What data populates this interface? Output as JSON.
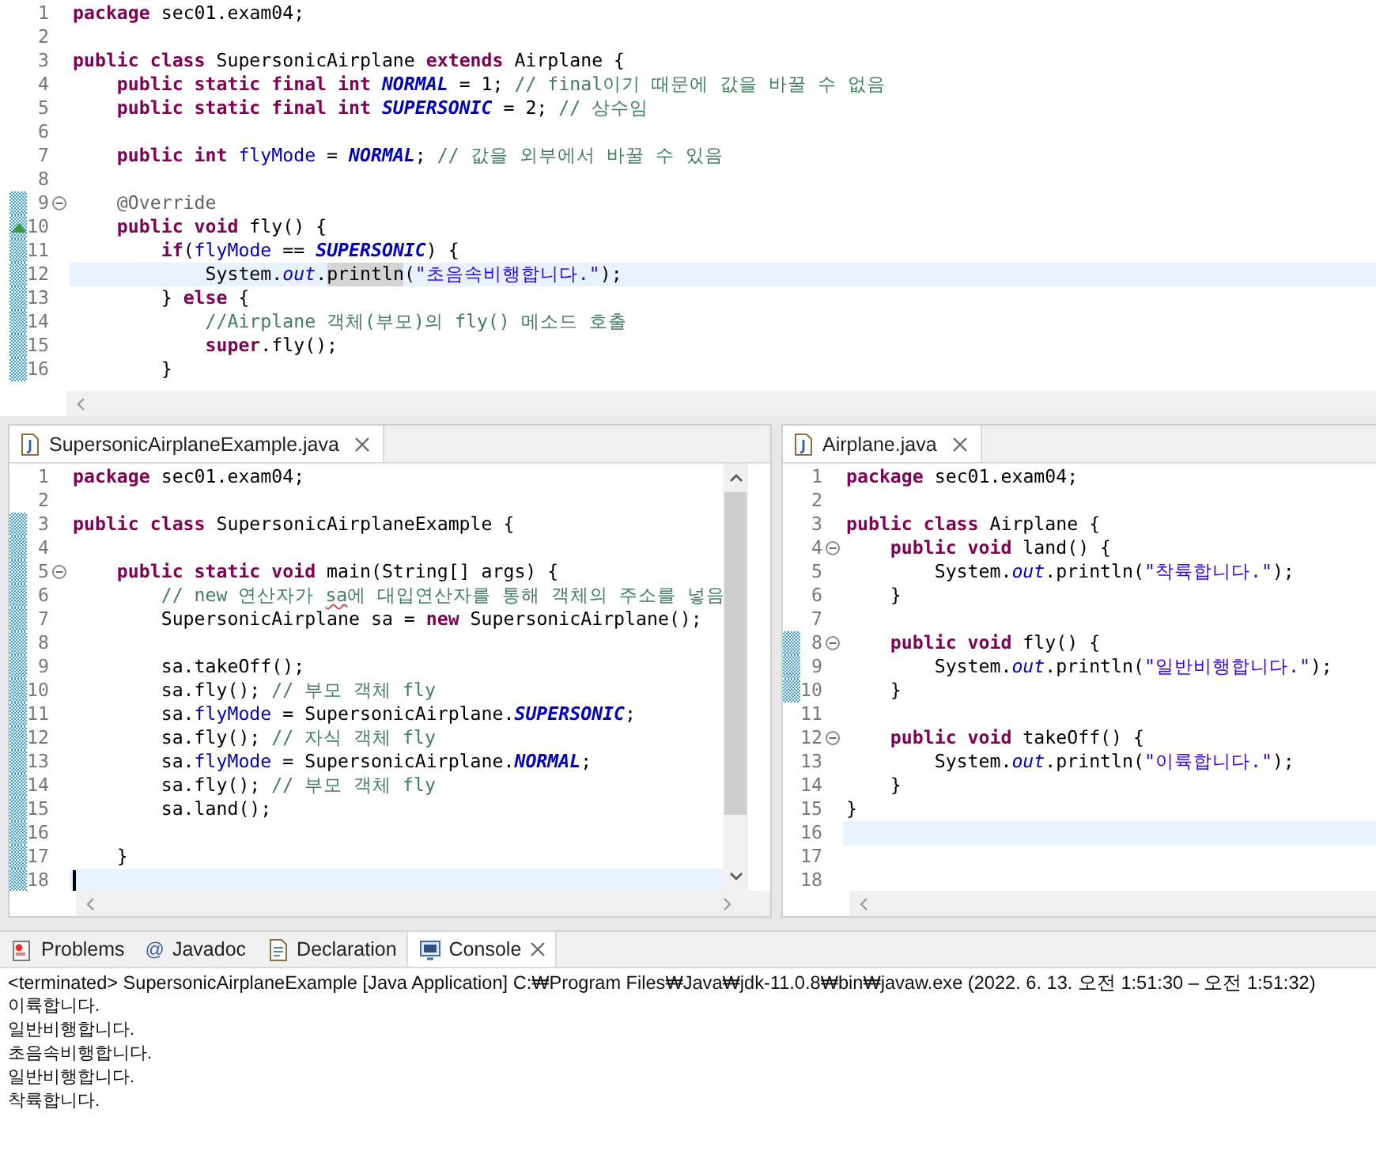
{
  "top_editor": {
    "horizontal_scrollbar": true,
    "vertical_scrollbar": false,
    "lines": [
      {
        "number": "1",
        "changed": false,
        "current": false,
        "fold": false,
        "tokens": [
          {
            "kind": "keyword",
            "text": "package"
          },
          {
            "kind": "plain",
            "text": " sec01.exam04;"
          }
        ]
      },
      {
        "number": "2",
        "changed": false,
        "current": false,
        "fold": false
      },
      {
        "number": "3",
        "changed": false,
        "current": false,
        "fold": false,
        "tokens": [
          {
            "kind": "keyword",
            "text": "public class"
          },
          {
            "kind": "plain",
            "text": " SupersonicAirplane "
          },
          {
            "kind": "keyword",
            "text": "extends"
          },
          {
            "kind": "plain",
            "text": " Airplane {"
          }
        ]
      },
      {
        "number": "4",
        "changed": false,
        "current": false,
        "fold": false,
        "tokens": [
          {
            "kind": "keyword",
            "text": "    public static final int "
          },
          {
            "kind": "constant",
            "text": "NORMAL"
          },
          {
            "kind": "plain",
            "text": " = 1; "
          },
          {
            "kind": "comment",
            "text": "// final이기 때문에 값을 바꿀 수 없음"
          }
        ]
      },
      {
        "number": "5",
        "changed": false,
        "current": false,
        "fold": false,
        "tokens": [
          {
            "kind": "keyword",
            "text": "    public static final int "
          },
          {
            "kind": "constant",
            "text": "SUPERSONIC"
          },
          {
            "kind": "plain",
            "text": " = 2; "
          },
          {
            "kind": "comment",
            "text": "// 상수임"
          }
        ]
      },
      {
        "number": "6",
        "changed": false,
        "current": false,
        "fold": false
      },
      {
        "number": "7",
        "changed": false,
        "current": false,
        "fold": false,
        "tokens": [
          {
            "kind": "keyword",
            "text": "    public int "
          },
          {
            "kind": "field",
            "text": "flyMode"
          },
          {
            "kind": "plain",
            "text": " = "
          },
          {
            "kind": "constant",
            "text": "NORMAL"
          },
          {
            "kind": "plain",
            "text": "; "
          },
          {
            "kind": "comment",
            "text": "// 값을 외부에서 바꿀 수 있음"
          }
        ]
      },
      {
        "number": "8",
        "changed": false,
        "current": false,
        "fold": false
      },
      {
        "number": "9",
        "changed": true,
        "current": false,
        "fold": true,
        "tokens": [
          {
            "kind": "annotation",
            "text": "    @Override"
          }
        ]
      },
      {
        "number": "10",
        "changed": true,
        "current": false,
        "fold": false,
        "override": true,
        "tokens": [
          {
            "kind": "keyword",
            "text": "    public void"
          },
          {
            "kind": "plain",
            "text": " fly() {"
          }
        ]
      },
      {
        "number": "11",
        "changed": true,
        "current": false,
        "fold": false,
        "tokens": [
          {
            "kind": "keyword",
            "text": "        if"
          },
          {
            "kind": "plain",
            "text": "("
          },
          {
            "kind": "field",
            "text": "flyMode"
          },
          {
            "kind": "plain",
            "text": " == "
          },
          {
            "kind": "constant",
            "text": "SUPERSONIC"
          },
          {
            "kind": "plain",
            "text": ") {"
          }
        ]
      },
      {
        "number": "12",
        "changed": true,
        "current": true,
        "fold": false,
        "tokens": [
          {
            "kind": "plain",
            "text": "            System."
          },
          {
            "kind": "static",
            "text": "out"
          },
          {
            "kind": "plain",
            "text": "."
          },
          {
            "kind": "occurrence",
            "text": "println"
          },
          {
            "kind": "plain",
            "text": "("
          },
          {
            "kind": "string",
            "text": "\"초음속비행합니다.\""
          },
          {
            "kind": "plain",
            "text": ");"
          }
        ]
      },
      {
        "number": "13",
        "changed": true,
        "current": false,
        "fold": false,
        "tokens": [
          {
            "kind": "plain",
            "text": "        } "
          },
          {
            "kind": "keyword",
            "text": "else"
          },
          {
            "kind": "plain",
            "text": " {"
          }
        ]
      },
      {
        "number": "14",
        "changed": true,
        "current": false,
        "fold": false,
        "tokens": [
          {
            "kind": "comment",
            "text": "            //Airplane 객체(부모)의 fly() 메소드 호출"
          }
        ]
      },
      {
        "number": "15",
        "changed": true,
        "current": false,
        "fold": false,
        "tokens": [
          {
            "kind": "keyword",
            "text": "            super"
          },
          {
            "kind": "plain",
            "text": ".fly();"
          }
        ]
      },
      {
        "number": "16",
        "changed": true,
        "current": false,
        "fold": false,
        "tokens": [
          {
            "kind": "plain",
            "text": "        }"
          }
        ]
      }
    ]
  },
  "editors": [
    {
      "tab_label": "SupersonicAirplaneExample.java",
      "horizontal_scrollbar": true,
      "vertical_scrollbar": true,
      "lines": [
        {
          "number": "1",
          "changed": false,
          "current": false,
          "fold": false,
          "tokens": [
            {
              "kind": "keyword",
              "text": "package"
            },
            {
              "kind": "plain",
              "text": " sec01.exam04;"
            }
          ]
        },
        {
          "number": "2",
          "changed": false,
          "current": false,
          "fold": false
        },
        {
          "number": "3",
          "changed": true,
          "current": false,
          "fold": false,
          "tokens": [
            {
              "kind": "keyword",
              "text": "public class"
            },
            {
              "kind": "plain",
              "text": " SupersonicAirplaneExample {"
            }
          ]
        },
        {
          "number": "4",
          "changed": true,
          "current": false,
          "fold": false
        },
        {
          "number": "5",
          "changed": true,
          "current": false,
          "fold": true,
          "tokens": [
            {
              "kind": "keyword",
              "text": "    public static void"
            },
            {
              "kind": "plain",
              "text": " main(String[] args) {"
            }
          ]
        },
        {
          "number": "6",
          "changed": true,
          "current": false,
          "fold": false,
          "tokens": [
            {
              "kind": "comment",
              "text": "        // new 연산자가 "
            },
            {
              "kind": "misspelled",
              "text": "sa"
            },
            {
              "kind": "comment",
              "text": "에 대입연산자를 통해 객체의 주소를 넣음"
            }
          ]
        },
        {
          "number": "7",
          "changed": true,
          "current": false,
          "fold": false,
          "tokens": [
            {
              "kind": "plain",
              "text": "        SupersonicAirplane sa = "
            },
            {
              "kind": "keyword",
              "text": "new"
            },
            {
              "kind": "plain",
              "text": " SupersonicAirplane();"
            }
          ]
        },
        {
          "number": "8",
          "changed": true,
          "current": false,
          "fold": false
        },
        {
          "number": "9",
          "changed": true,
          "current": false,
          "fold": false,
          "tokens": [
            {
              "kind": "plain",
              "text": "        sa.takeOff();"
            }
          ]
        },
        {
          "number": "10",
          "changed": true,
          "current": false,
          "fold": false,
          "tokens": [
            {
              "kind": "plain",
              "text": "        sa.fly(); "
            },
            {
              "kind": "comment",
              "text": "// 부모 객체 fly"
            }
          ]
        },
        {
          "number": "11",
          "changed": true,
          "current": false,
          "fold": false,
          "tokens": [
            {
              "kind": "plain",
              "text": "        sa."
            },
            {
              "kind": "field",
              "text": "flyMode"
            },
            {
              "kind": "plain",
              "text": " = SupersonicAirplane."
            },
            {
              "kind": "constant",
              "text": "SUPERSONIC"
            },
            {
              "kind": "plain",
              "text": ";"
            }
          ]
        },
        {
          "number": "12",
          "changed": true,
          "current": false,
          "fold": false,
          "tokens": [
            {
              "kind": "plain",
              "text": "        sa.fly(); "
            },
            {
              "kind": "comment",
              "text": "// 자식 객체 fly"
            }
          ]
        },
        {
          "number": "13",
          "changed": true,
          "current": false,
          "fold": false,
          "tokens": [
            {
              "kind": "plain",
              "text": "        sa."
            },
            {
              "kind": "field",
              "text": "flyMode"
            },
            {
              "kind": "plain",
              "text": " = SupersonicAirplane."
            },
            {
              "kind": "constant",
              "text": "NORMAL"
            },
            {
              "kind": "plain",
              "text": ";"
            }
          ]
        },
        {
          "number": "14",
          "changed": true,
          "current": false,
          "fold": false,
          "tokens": [
            {
              "kind": "plain",
              "text": "        sa.fly(); "
            },
            {
              "kind": "comment",
              "text": "// 부모 객체 fly"
            }
          ]
        },
        {
          "number": "15",
          "changed": true,
          "current": false,
          "fold": false,
          "tokens": [
            {
              "kind": "plain",
              "text": "        sa.land();"
            }
          ]
        },
        {
          "number": "16",
          "changed": true,
          "current": false,
          "fold": false
        },
        {
          "number": "17",
          "changed": true,
          "current": false,
          "fold": false,
          "tokens": [
            {
              "kind": "plain",
              "text": "    }"
            }
          ]
        },
        {
          "number": "18",
          "changed": true,
          "current": true,
          "fold": false,
          "caret": true
        }
      ]
    },
    {
      "tab_label": "Airplane.java",
      "horizontal_scrollbar": true,
      "vertical_scrollbar": false,
      "lines": [
        {
          "number": "1",
          "changed": false,
          "current": false,
          "fold": false,
          "tokens": [
            {
              "kind": "keyword",
              "text": "package"
            },
            {
              "kind": "plain",
              "text": " sec01.exam04;"
            }
          ]
        },
        {
          "number": "2",
          "changed": false,
          "current": false,
          "fold": false
        },
        {
          "number": "3",
          "changed": false,
          "current": false,
          "fold": false,
          "tokens": [
            {
              "kind": "keyword",
              "text": "public class"
            },
            {
              "kind": "plain",
              "text": " Airplane {"
            }
          ]
        },
        {
          "number": "4",
          "changed": false,
          "current": false,
          "fold": true,
          "tokens": [
            {
              "kind": "keyword",
              "text": "    public void"
            },
            {
              "kind": "plain",
              "text": " land() {"
            }
          ]
        },
        {
          "number": "5",
          "changed": false,
          "current": false,
          "fold": false,
          "tokens": [
            {
              "kind": "plain",
              "text": "        System."
            },
            {
              "kind": "static",
              "text": "out"
            },
            {
              "kind": "plain",
              "text": ".println("
            },
            {
              "kind": "string",
              "text": "\"착륙합니다.\""
            },
            {
              "kind": "plain",
              "text": ");"
            }
          ]
        },
        {
          "number": "6",
          "changed": false,
          "current": false,
          "fold": false,
          "tokens": [
            {
              "kind": "plain",
              "text": "    }"
            }
          ]
        },
        {
          "number": "7",
          "changed": false,
          "current": false,
          "fold": false
        },
        {
          "number": "8",
          "changed": true,
          "current": false,
          "fold": true,
          "tokens": [
            {
              "kind": "keyword",
              "text": "    public void"
            },
            {
              "kind": "plain",
              "text": " fly() {"
            }
          ]
        },
        {
          "number": "9",
          "changed": true,
          "current": false,
          "fold": false,
          "tokens": [
            {
              "kind": "plain",
              "text": "        System."
            },
            {
              "kind": "static",
              "text": "out"
            },
            {
              "kind": "plain",
              "text": ".println("
            },
            {
              "kind": "string",
              "text": "\"일반비행합니다.\""
            },
            {
              "kind": "plain",
              "text": ");"
            }
          ]
        },
        {
          "number": "10",
          "changed": true,
          "current": false,
          "fold": false,
          "tokens": [
            {
              "kind": "plain",
              "text": "    }"
            }
          ]
        },
        {
          "number": "11",
          "changed": false,
          "current": false,
          "fold": false
        },
        {
          "number": "12",
          "changed": false,
          "current": false,
          "fold": true,
          "tokens": [
            {
              "kind": "keyword",
              "text": "    public void"
            },
            {
              "kind": "plain",
              "text": " takeOff() {"
            }
          ]
        },
        {
          "number": "13",
          "changed": false,
          "current": false,
          "fold": false,
          "tokens": [
            {
              "kind": "plain",
              "text": "        System."
            },
            {
              "kind": "static",
              "text": "out"
            },
            {
              "kind": "plain",
              "text": ".println("
            },
            {
              "kind": "string",
              "text": "\"이륙합니다.\""
            },
            {
              "kind": "plain",
              "text": ");"
            }
          ]
        },
        {
          "number": "14",
          "changed": false,
          "current": false,
          "fold": false,
          "tokens": [
            {
              "kind": "plain",
              "text": "    }"
            }
          ]
        },
        {
          "number": "15",
          "changed": false,
          "current": false,
          "fold": false,
          "tokens": [
            {
              "kind": "plain",
              "text": "}"
            }
          ]
        },
        {
          "number": "16",
          "changed": false,
          "current": true,
          "fold": false
        },
        {
          "number": "17",
          "changed": false,
          "current": false,
          "fold": false
        },
        {
          "number": "18",
          "changed": false,
          "current": false,
          "fold": false
        }
      ]
    }
  ],
  "console": {
    "tabs": [
      {
        "kind": "problems",
        "label": "Problems",
        "selected": false
      },
      {
        "kind": "javadoc",
        "glyph": "@",
        "label": "Javadoc",
        "selected": false
      },
      {
        "kind": "declaration",
        "label": "Declaration",
        "selected": false
      },
      {
        "kind": "console",
        "label": "Console",
        "selected": true
      }
    ],
    "header": "<terminated> SupersonicAirplaneExample [Java Application] C:₩Program Files₩Java₩jdk-11.0.8₩bin₩javaw.exe  (2022. 6. 13. 오전 1:51:30 – 오전 1:51:32)",
    "output": [
      "이륙합니다.",
      "일반비행합니다.",
      "초음속비행합니다.",
      "일반비행합니다.",
      "착륙합니다."
    ]
  }
}
